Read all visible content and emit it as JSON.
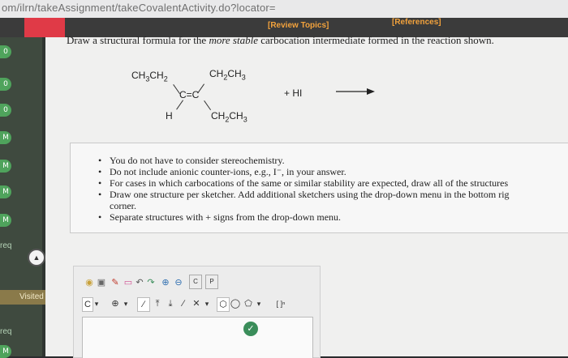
{
  "browser": {
    "url": "om/ilrn/takeAssignment/takeCovalentActivity.do?locator="
  },
  "header": {
    "review_topics": "[Review Topics]",
    "references": "[References]"
  },
  "left_panel": {
    "badges": [
      "0",
      "0",
      "0",
      "M",
      "M",
      "M",
      "M"
    ],
    "req_label": "req",
    "visited_label": "Visited",
    "req_label_bottom": "req",
    "last_badge": "M"
  },
  "question": {
    "prefix": "Draw a structural formula for the ",
    "emphasis": "more stable",
    "suffix": " carbocation intermediate formed in the reaction shown."
  },
  "reaction": {
    "top_left": "CH3CH2",
    "top_right": "CH2CH3",
    "double_bond": "C=C",
    "bottom_left": "H",
    "bottom_right": "CH2CH3",
    "reagent": "+ HI"
  },
  "instructions": [
    "You do not have to consider stereochemistry.",
    "Do not include anionic counter-ions, e.g., I⁻, in your answer.",
    "For cases in which carbocations of the same or similar stability are expected, draw all of the structures",
    "Draw one structure per sketcher. Add additional sketchers using the drop-down menu in the bottom rig",
    "corner.",
    "Separate structures with + signs from the drop-down menu."
  ],
  "sketcher": {
    "element_c": "C",
    "charge": "⊕",
    "bracket": "[ ]ⁿ",
    "copy": "C",
    "paste": "P"
  }
}
